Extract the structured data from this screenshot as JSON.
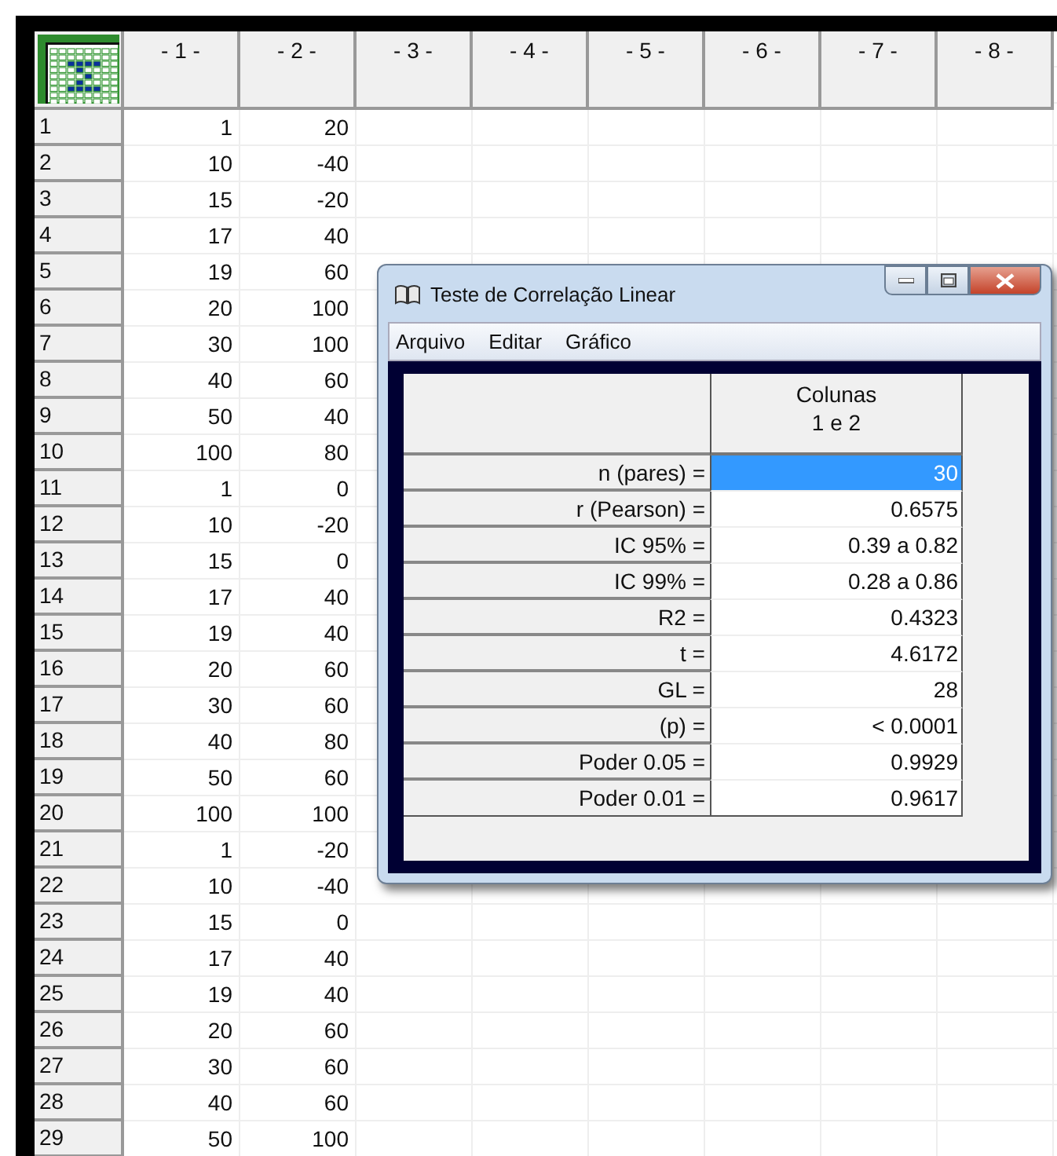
{
  "sheet": {
    "columns": [
      "- 1 -",
      "- 2 -",
      "- 3 -",
      "- 4 -",
      "- 5 -",
      "- 6 -",
      "- 7 -",
      "- 8 -"
    ],
    "rows": [
      {
        "label": "1",
        "cells": [
          "1",
          "20"
        ]
      },
      {
        "label": "2",
        "cells": [
          "10",
          "-40"
        ]
      },
      {
        "label": "3",
        "cells": [
          "15",
          "-20"
        ]
      },
      {
        "label": "4",
        "cells": [
          "17",
          "40"
        ]
      },
      {
        "label": "5",
        "cells": [
          "19",
          "60"
        ]
      },
      {
        "label": "6",
        "cells": [
          "20",
          "100"
        ]
      },
      {
        "label": "7",
        "cells": [
          "30",
          "100"
        ]
      },
      {
        "label": "8",
        "cells": [
          "40",
          "60"
        ]
      },
      {
        "label": "9",
        "cells": [
          "50",
          "40"
        ]
      },
      {
        "label": "10",
        "cells": [
          "100",
          "80"
        ]
      },
      {
        "label": "11",
        "cells": [
          "1",
          "0"
        ]
      },
      {
        "label": "12",
        "cells": [
          "10",
          "-20"
        ]
      },
      {
        "label": "13",
        "cells": [
          "15",
          "0"
        ]
      },
      {
        "label": "14",
        "cells": [
          "17",
          "40"
        ]
      },
      {
        "label": "15",
        "cells": [
          "19",
          "40"
        ]
      },
      {
        "label": "16",
        "cells": [
          "20",
          "60"
        ]
      },
      {
        "label": "17",
        "cells": [
          "30",
          "60"
        ]
      },
      {
        "label": "18",
        "cells": [
          "40",
          "80"
        ]
      },
      {
        "label": "19",
        "cells": [
          "50",
          "60"
        ]
      },
      {
        "label": "20",
        "cells": [
          "100",
          "100"
        ]
      },
      {
        "label": "21",
        "cells": [
          "1",
          "-20"
        ]
      },
      {
        "label": "22",
        "cells": [
          "10",
          "-40"
        ]
      },
      {
        "label": "23",
        "cells": [
          "15",
          "0"
        ]
      },
      {
        "label": "24",
        "cells": [
          "17",
          "40"
        ]
      },
      {
        "label": "25",
        "cells": [
          "19",
          "40"
        ]
      },
      {
        "label": "26",
        "cells": [
          "20",
          "60"
        ]
      },
      {
        "label": "27",
        "cells": [
          "30",
          "60"
        ]
      },
      {
        "label": "28",
        "cells": [
          "40",
          "60"
        ]
      },
      {
        "label": "29",
        "cells": [
          "50",
          "100"
        ]
      }
    ]
  },
  "dialog": {
    "title": "Teste de Correlação Linear",
    "menu": [
      "Arquivo",
      "Editar",
      "Gráfico"
    ],
    "column_header": [
      "Colunas",
      "1 e  2"
    ],
    "results": [
      {
        "label": "n (pares) =",
        "value": "30",
        "selected": true
      },
      {
        "label": "r (Pearson) =",
        "value": "0.6575",
        "selected": false
      },
      {
        "label": "IC 95% =",
        "value": "0.39 a 0.82",
        "selected": false
      },
      {
        "label": "IC 99% =",
        "value": "0.28 a 0.86",
        "selected": false
      },
      {
        "label": "R2 =",
        "value": "0.4323",
        "selected": false
      },
      {
        "label": "t =",
        "value": "4.6172",
        "selected": false
      },
      {
        "label": "GL =",
        "value": "28",
        "selected": false
      },
      {
        "label": "(p)  =",
        "value": "< 0.0001",
        "selected": false
      },
      {
        "label": "Poder 0.05 =",
        "value": "0.9929",
        "selected": false
      },
      {
        "label": "Poder 0.01 =",
        "value": "0.9617",
        "selected": false
      }
    ]
  }
}
